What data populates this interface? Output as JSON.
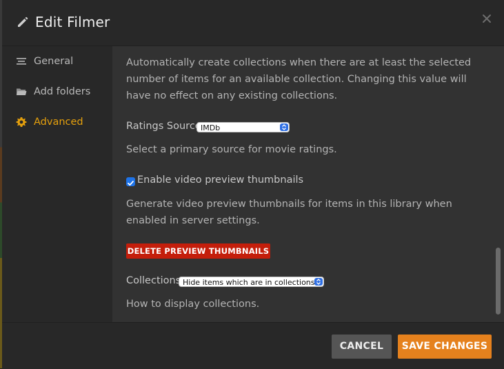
{
  "dialog": {
    "title": "Edit Filmer"
  },
  "sidebar": {
    "items": [
      {
        "label": "General",
        "icon": "list-icon",
        "active": false
      },
      {
        "label": "Add folders",
        "icon": "folder-icon",
        "active": false
      },
      {
        "label": "Advanced",
        "icon": "gear-icon",
        "active": true
      }
    ]
  },
  "content": {
    "collections_description": "Automatically create collections when there are at least the selected number of items for an available collection. Changing this value will have no effect on any existing collections.",
    "ratings_source": {
      "label": "Ratings Source",
      "value": "IMDb",
      "help": "Select a primary source for movie ratings."
    },
    "preview_thumbnails": {
      "label": "Enable video preview thumbnails",
      "checked": true,
      "help": "Generate video preview thumbnails for items in this library when enabled in server settings.",
      "delete_label": "DELETE PREVIEW THUMBNAILS"
    },
    "collections": {
      "label": "Collections",
      "value": "Hide items which are in collections",
      "help": "How to display collections."
    }
  },
  "footer": {
    "cancel_label": "CANCEL",
    "save_label": "SAVE CHANGES"
  },
  "colors": {
    "accent": "#e5a00d",
    "save": "#e5811d",
    "danger": "#c41e0b",
    "checkbox": "#1e73e8"
  }
}
